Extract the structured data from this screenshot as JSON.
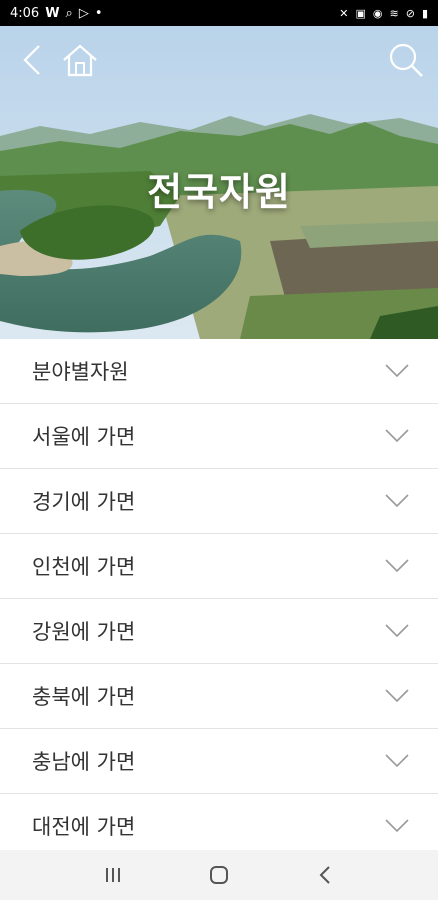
{
  "status_bar": {
    "time": "4:06"
  },
  "hero": {
    "title": "전국자원"
  },
  "list": {
    "items": [
      {
        "label": "분야별자원"
      },
      {
        "label": "서울에 가면"
      },
      {
        "label": "경기에 가면"
      },
      {
        "label": "인천에 가면"
      },
      {
        "label": "강원에 가면"
      },
      {
        "label": "충북에 가면"
      },
      {
        "label": "충남에 가면"
      },
      {
        "label": "대전에 가면"
      }
    ]
  },
  "icons": {
    "back": "back-chevron-icon",
    "home": "home-icon",
    "search": "search-icon",
    "chevron": "chevron-down-icon",
    "recents": "recents-icon",
    "nav_home": "nav-home-icon",
    "nav_back": "nav-back-icon"
  }
}
